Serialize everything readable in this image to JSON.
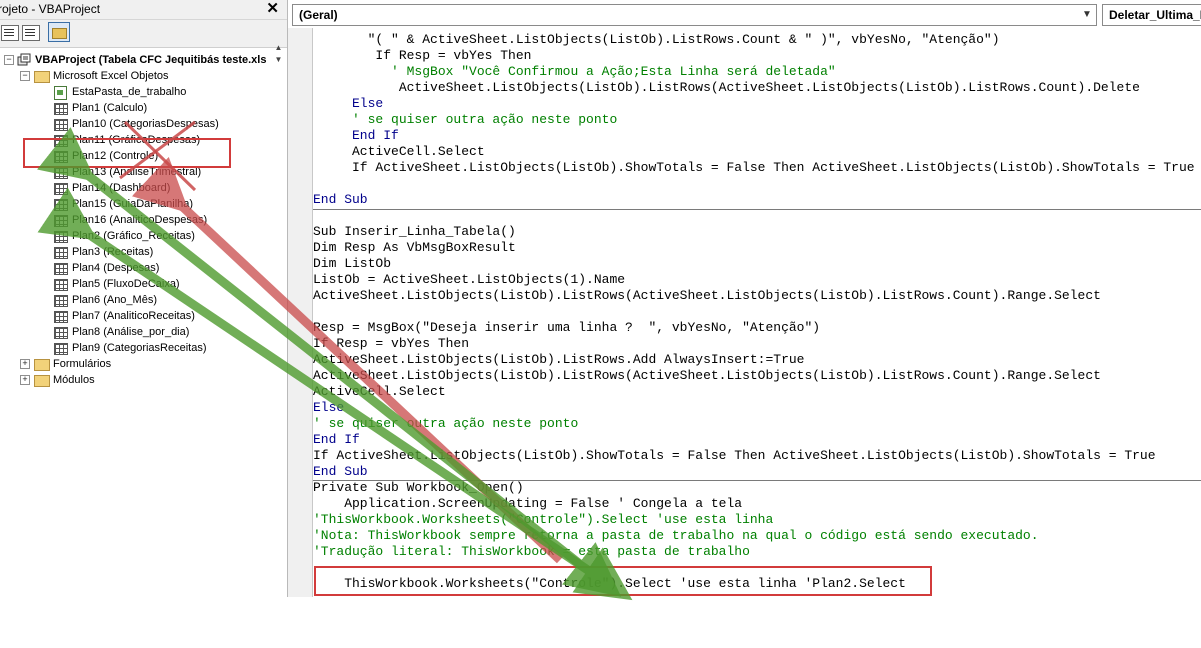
{
  "project_panel": {
    "title": "rojeto - VBAProject",
    "close_label": "✕",
    "tree": {
      "root": "VBAProject (Tabela CFC Jequitibás teste.xls",
      "excel_objects": "Microsoft Excel Objetos",
      "items": [
        "EstaPasta_de_trabalho",
        "Plan1 (Calculo)",
        "Plan10 (CategoriasDespesas)",
        "Plan11 (GráficoDespesas)",
        "Plan12 (Controle)",
        "Plan13 (AnaliseTrimestral)",
        "Plan14 (Dashboard)",
        "Plan15 (GuiaDaPlanilha)",
        "Plan16 (AnaliticoDespesas)",
        "Plan2 (Gráfico_Receitas)",
        "Plan3 (Receitas)",
        "Plan4 (Despesas)",
        "Plan5 (FluxoDeCaixa)",
        "Plan6 (Ano_Mês)",
        "Plan7 (AnaliticoReceitas)",
        "Plan8 (Análise_por_dia)",
        "Plan9 (CategoriasReceitas)"
      ],
      "forms": "Formulários",
      "modules": "Módulos"
    }
  },
  "code_window": {
    "object_combo": "(Geral)",
    "proc_combo": "Deletar_Ultima_L",
    "lines": [
      "       \"( \" & ActiveSheet.ListObjects(ListOb).ListRows.Count & \" )\", vbYesNo, \"Atenção\")",
      "        If Resp = vbYes Then",
      "          ' MsgBox \"Você Confirmou a Ação;Esta Linha será deletada\"",
      "           ActiveSheet.ListObjects(ListOb).ListRows(ActiveSheet.ListObjects(ListOb).ListRows.Count).Delete",
      "     Else",
      "     ' se quiser outra ação neste ponto",
      "     End If",
      "     ActiveCell.Select",
      "     If ActiveSheet.ListObjects(ListOb).ShowTotals = False Then ActiveSheet.ListObjects(ListOb).ShowTotals = True",
      "",
      "End Sub",
      "",
      "Sub Inserir_Linha_Tabela()",
      "Dim Resp As VbMsgBoxResult",
      "Dim ListOb",
      "ListOb = ActiveSheet.ListObjects(1).Name",
      "ActiveSheet.ListObjects(ListOb).ListRows(ActiveSheet.ListObjects(ListOb).ListRows.Count).Range.Select",
      "",
      "Resp = MsgBox(\"Deseja inserir uma linha ?  \", vbYesNo, \"Atenção\")",
      "If Resp = vbYes Then",
      "ActiveSheet.ListObjects(ListOb).ListRows.Add AlwaysInsert:=True",
      "ActiveSheet.ListObjects(ListOb).ListRows(ActiveSheet.ListObjects(ListOb).ListRows.Count).Range.Select",
      "ActiveCell.Select",
      "Else",
      "' se quiser outra ação neste ponto",
      "End If",
      "If ActiveSheet.ListObjects(ListOb).ShowTotals = False Then ActiveSheet.ListObjects(ListOb).ShowTotals = True",
      "End Sub",
      "Private Sub Workbook_Open()",
      "    Application.ScreenUpdating = False ' Congela a tela",
      "'ThisWorkbook.Worksheets(\"Controle\").Select 'use esta linha",
      "'Nota: ThisWorkbook sempre retorna a pasta de trabalho na qual o código está sendo executado.",
      "'Tradução literal: ThisWorkbook = esta pasta de trabalho",
      "",
      "    ThisWorkbook.Worksheets(\"Controle\").Select 'use esta linha 'Plan2.Select"
    ]
  }
}
